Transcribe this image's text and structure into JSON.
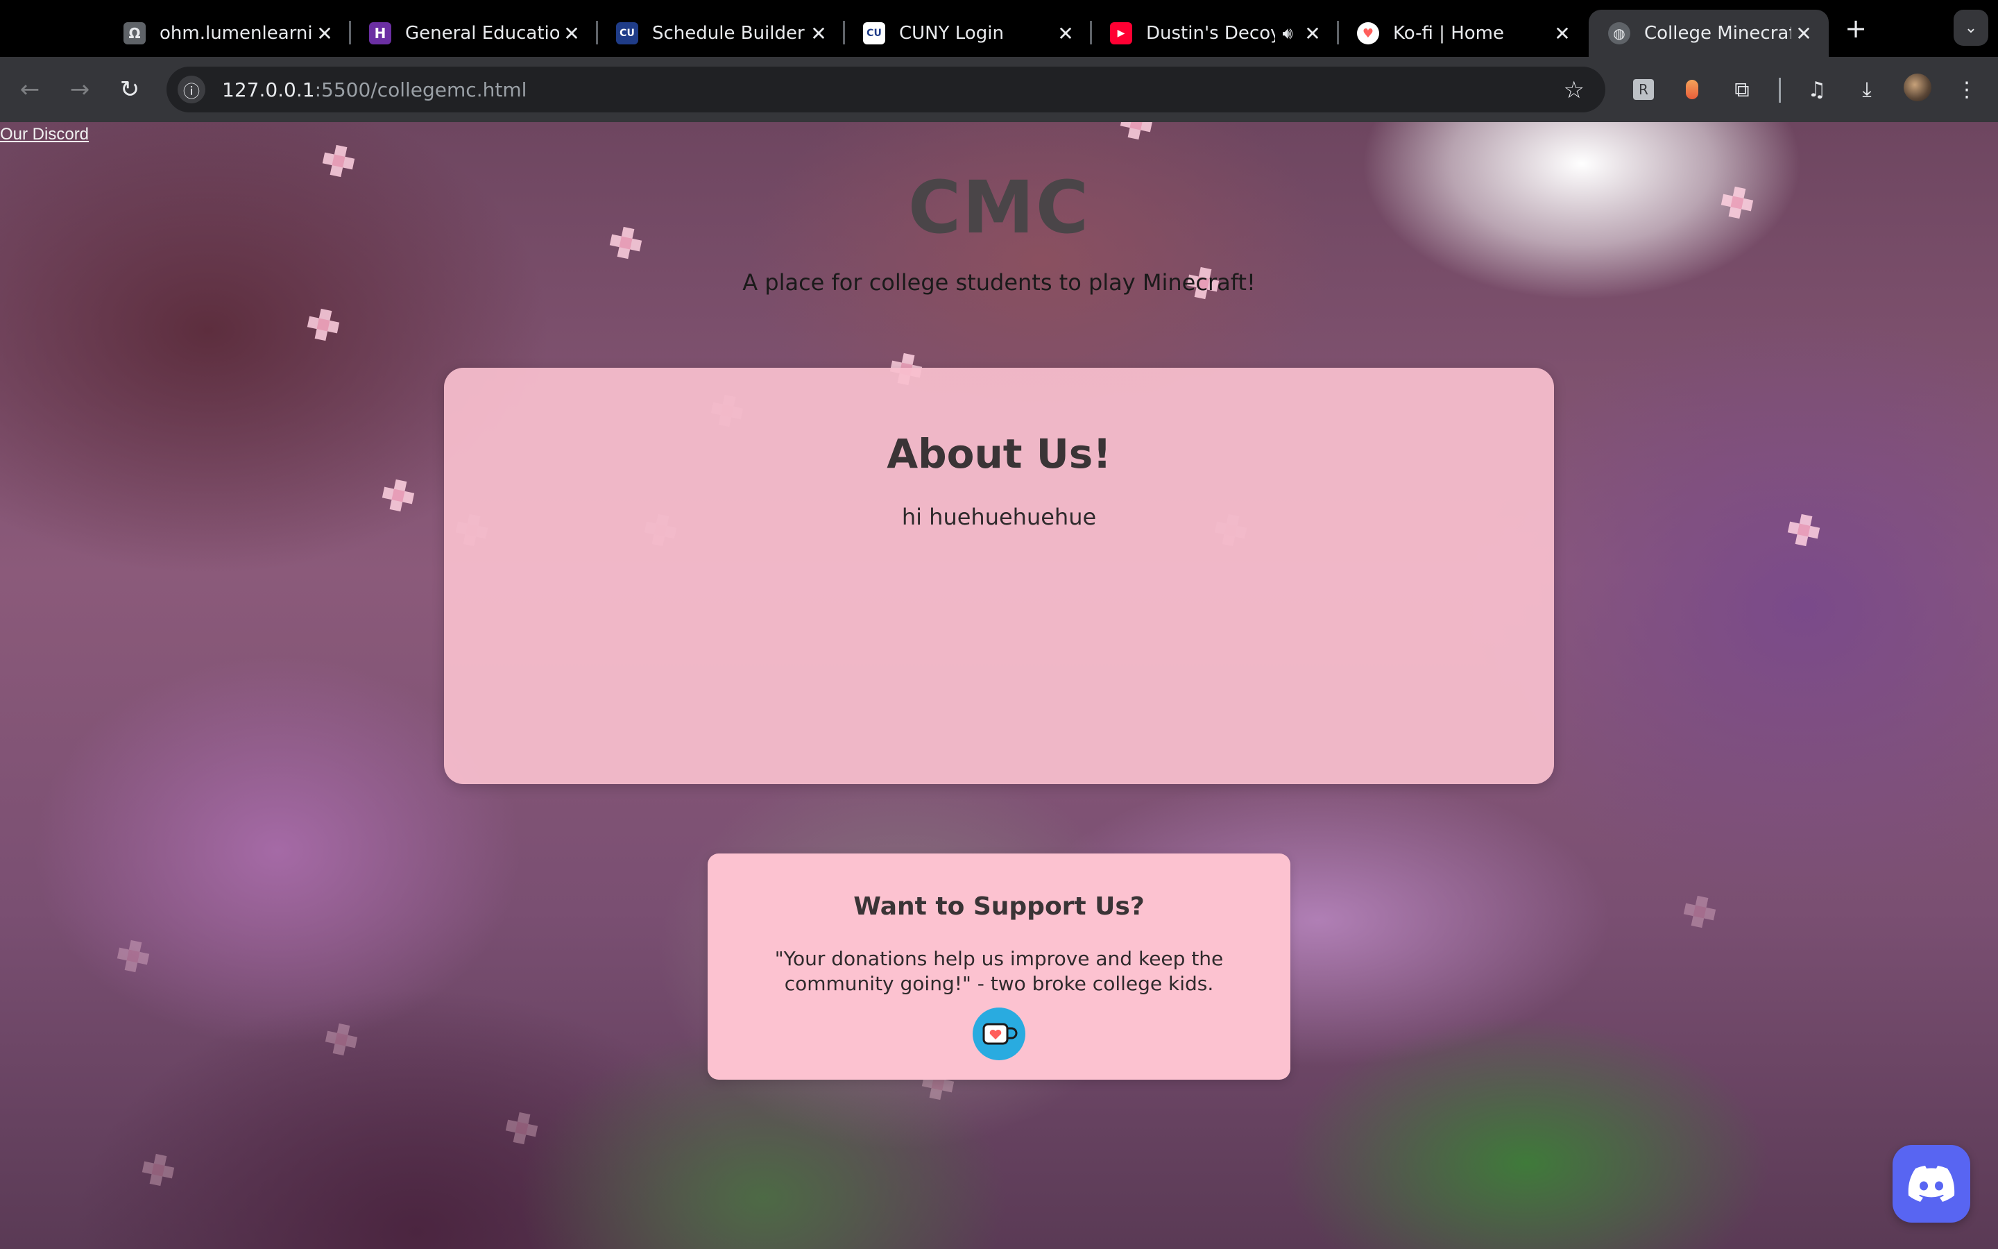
{
  "browser": {
    "tabs": [
      {
        "title": "ohm.lumenlearning",
        "icon": "omega-icon",
        "active": false
      },
      {
        "title": "General Education",
        "icon": "h-logo-icon",
        "active": false
      },
      {
        "title": "Schedule Builder",
        "icon": "cuny-icon",
        "active": false
      },
      {
        "title": "CUNY Login",
        "icon": "cuny-icon",
        "active": false
      },
      {
        "title": "Dustin's Decoy",
        "icon": "youtube-icon",
        "active": false,
        "audio": true
      },
      {
        "title": "Ko-fi | Home",
        "icon": "kofi-icon",
        "active": false
      },
      {
        "title": "College Minecraft!",
        "icon": "globe-icon",
        "active": true
      }
    ],
    "url_host": "127.0.0.1",
    "url_path": ":5500/collegemc.html"
  },
  "page": {
    "discord_link": "Our Discord",
    "title": "CMC",
    "tagline": "A place for college students to play Minecraft!",
    "about": {
      "heading": "About Us!",
      "text": "hi huehuehuehue"
    },
    "support": {
      "heading": "Want to Support Us?",
      "quote": "\"Your donations help us improve and keep the community going!\" - two broke college kids."
    }
  },
  "colors": {
    "tab_strip": "#000000",
    "toolbar": "#35363a",
    "card_pink": "#f8becd",
    "kofi_blue": "#29abe0",
    "discord_blurple": "#5865f2"
  }
}
